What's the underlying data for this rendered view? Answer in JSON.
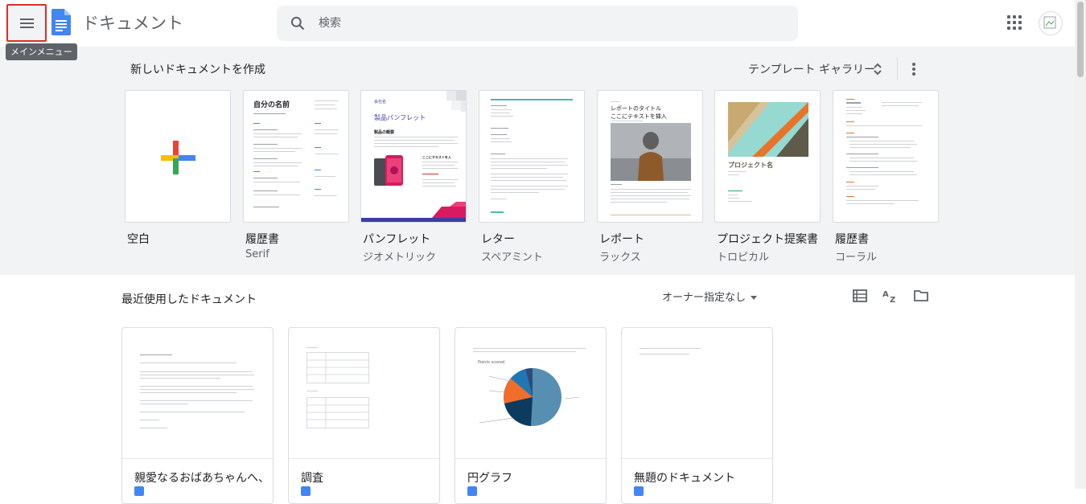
{
  "header": {
    "menu_tooltip": "メインメニュー",
    "app_title": "ドキュメント",
    "search_placeholder": "検索"
  },
  "templates": {
    "heading": "新しいドキュメントを作成",
    "gallery_label": "テンプレート ギャラリー",
    "items": [
      {
        "name": "空白",
        "sub": ""
      },
      {
        "name": "履歴書",
        "sub": "Serif",
        "preview_title": "自分の名前"
      },
      {
        "name": "パンフレット",
        "sub": "ジオメトリック",
        "preview_title": "製品パンフレット",
        "preview_company": "会社名",
        "preview_heading": "製品の概要",
        "preview_sub": "ここにテキストを入"
      },
      {
        "name": "レター",
        "sub": "スペアミント"
      },
      {
        "name": "レポート",
        "sub": "ラックス",
        "preview_title": "レポートのタイトル",
        "preview_sub": "ここにテキストを挿入"
      },
      {
        "name": "プロジェクト提案書",
        "sub": "トロピカル",
        "preview_title": "プロジェクト名"
      },
      {
        "name": "履歴書",
        "sub": "コーラル"
      }
    ]
  },
  "recent": {
    "heading": "最近使用したドキュメント",
    "owner_filter": "オーナー指定なし",
    "docs": [
      {
        "title": "親愛なるおばあちゃんへ、"
      },
      {
        "title": "調査"
      },
      {
        "title": "円グラフ",
        "chart_title": "Points scored"
      },
      {
        "title": "無題のドキュメント"
      }
    ]
  },
  "colors": {
    "accent_blue": "#4285f4",
    "highlight_red": "#d93025",
    "template_bg": "#f1f3f4"
  }
}
